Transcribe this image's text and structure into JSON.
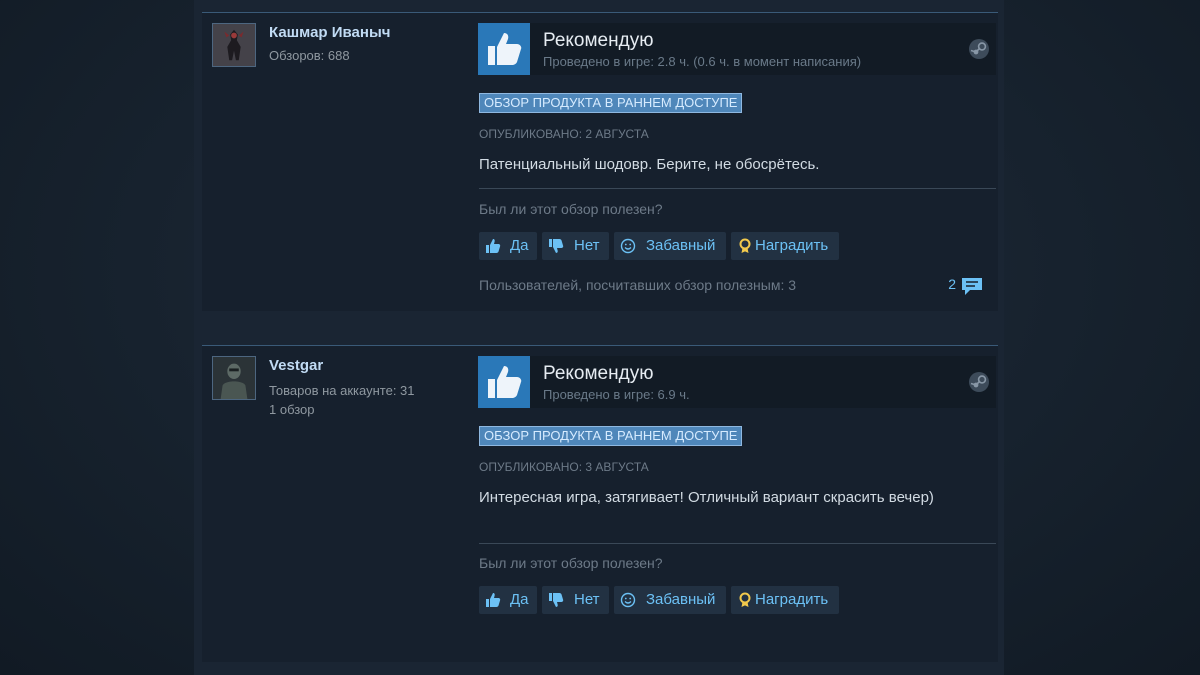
{
  "colors": {
    "accent_link": "#6cc1f5",
    "author_name": "#c1dbf4",
    "thumb_tile": "#2a78b8",
    "early_access_badge": "#4f87ba"
  },
  "reviews": [
    {
      "author": "Кашмар Иваныч",
      "stats": [
        "Обзоров: 688"
      ],
      "avatar_icon": "avatar-icon",
      "recommendation": "Рекомендую",
      "playtime": "Проведено в игре: 2.8 ч. (0.6 ч. в момент написания)",
      "early_access": "ОБЗОР ПРОДУКТА В РАННЕМ ДОСТУПЕ",
      "posted": "ОПУБЛИКОВАНО: 2 АВГУСТА",
      "text": "Патенциальный шодовр. Берите, не обосрётесь.",
      "helpful_question": "Был ли этот обзор полезен?",
      "buttons": {
        "yes": "Да",
        "no": "Нет",
        "funny": "Забавный",
        "award": "Наградить"
      },
      "helpful_count": "Пользователей, посчитавших обзор полезным: 3",
      "comments": "2"
    },
    {
      "author": "Vestgar",
      "stats": [
        "Товаров на аккаунте: 31",
        "1 обзор"
      ],
      "avatar_icon": "avatar-icon",
      "recommendation": "Рекомендую",
      "playtime": "Проведено в игре: 6.9 ч.",
      "early_access": "ОБЗОР ПРОДУКТА В РАННЕМ ДОСТУПЕ",
      "posted": "ОПУБЛИКОВАНО: 3 АВГУСТА",
      "text": "Интересная игра, затягивает! Отличный вариант скрасить вечер)",
      "helpful_question": "Был ли этот обзор полезен?",
      "buttons": {
        "yes": "Да",
        "no": "Нет",
        "funny": "Забавный",
        "award": "Наградить"
      }
    }
  ]
}
